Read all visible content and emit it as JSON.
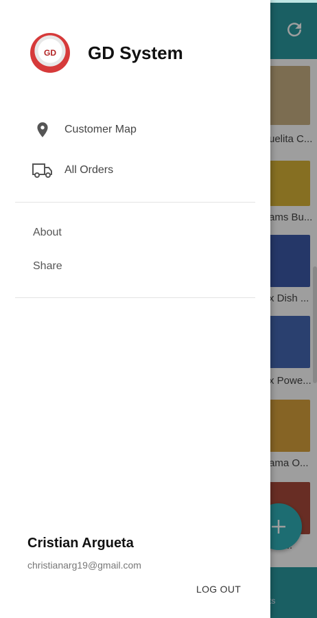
{
  "app": {
    "products": [
      {
        "name": "uelita C...",
        "thumb_color": "#c9b184"
      },
      {
        "name": "ams Bu...",
        "thumb_color": "#d9b338"
      },
      {
        "name": "x Dish ...",
        "thumb_color": "#3c5aa8"
      },
      {
        "name": "x Powe...",
        "thumb_color": "#4468b4"
      },
      {
        "name": "ama O...",
        "thumb_color": "#d9a23d"
      },
      {
        "name": "ara...",
        "thumb_color": "#a84a3a"
      }
    ],
    "bottom_label": "ts"
  },
  "drawer": {
    "title": "GD System",
    "logo_text": "GD",
    "menu": [
      {
        "label": "Customer Map",
        "icon": "map-pin-icon"
      },
      {
        "label": "All Orders",
        "icon": "truck-icon"
      }
    ],
    "secondary": [
      {
        "label": "About"
      },
      {
        "label": "Share"
      }
    ],
    "user": {
      "name": "Cristian Argueta",
      "email": "christianarg19@gmail.com"
    },
    "logout_label": "LOG OUT"
  },
  "colors": {
    "teal": "#2a9aa0",
    "fab": "#2fb1b8"
  }
}
